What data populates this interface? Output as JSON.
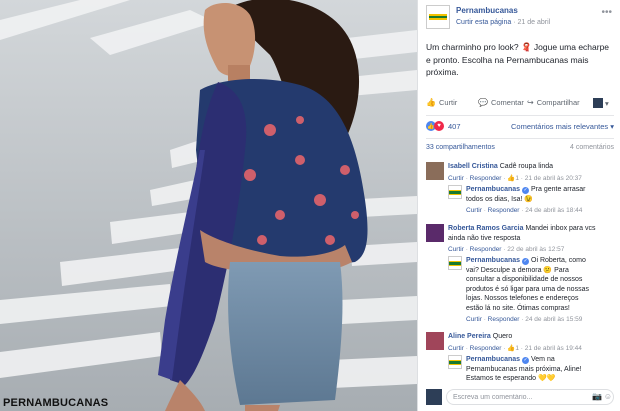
{
  "photo": {
    "brand_logo": "PERNAMBUCANAS"
  },
  "post": {
    "page_name": "Pernambucanas",
    "like_page": "Curtir esta página",
    "date": "21 de abril",
    "text": "Um charminho pro look? 🧣 Jogue uma echarpe e pronto. Escolha na Pernambucanas mais próxima.",
    "actions": {
      "like": "Curtir",
      "comment": "Comentar",
      "share": "Compartilhar"
    },
    "reaction_count": "407",
    "sort_label": "Comentários mais relevantes",
    "shares": "33 compartilhamentos",
    "comment_count": "4 comentários"
  },
  "comments": [
    {
      "author": "Isabell Cristina",
      "text": "Cadê roupa linda",
      "like": "Curtir",
      "reply": "Responder",
      "count": "1",
      "date": "21 de abril às 20:37",
      "replies": [
        {
          "author": "Pernambucanas",
          "text": "Pra gente arrasar todos os dias, Isa! 😉",
          "like": "Curtir",
          "reply": "Responder",
          "date": "24 de abril às 18:44"
        }
      ]
    },
    {
      "author": "Roberta Ramos Garcia",
      "text": "Mandei inbox para vcs ainda não tive resposta",
      "like": "Curtir",
      "reply": "Responder",
      "date": "22 de abril às 12:57",
      "replies": [
        {
          "author": "Pernambucanas",
          "text": "Oi Roberta, como vai? Desculpe a demora 😕 Para consultar a disponibilidade de nossos produtos é só ligar para uma de nossas lojas. Nossos telefones e endereços estão lá no site. Ótimas compras!",
          "like": "Curtir",
          "reply": "Responder",
          "date": "24 de abril às 15:59"
        }
      ]
    },
    {
      "author": "Aline Pereira",
      "text": "Quero",
      "like": "Curtir",
      "reply": "Responder",
      "count": "1",
      "date": "21 de abril às 19:44",
      "replies": [
        {
          "author": "Pernambucanas",
          "text": "Vem na Pernambucanas mais próxima, Aline! Estamos te esperando 💛💛"
        }
      ]
    }
  ],
  "composer": {
    "placeholder": "Escreva um comentário..."
  },
  "colors": {
    "link": "#365899",
    "brand_green": "#1a7a2e",
    "brand_yellow": "#f2c200"
  }
}
